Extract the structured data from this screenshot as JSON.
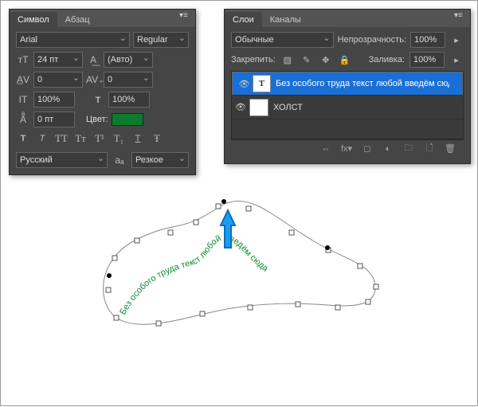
{
  "charPanel": {
    "tabs": [
      "Символ",
      "Абзац"
    ],
    "activeTab": 0,
    "font": "Arial",
    "style": "Regular",
    "size": "24 пт",
    "leading": "(Авто)",
    "kerning": "0",
    "tracking": "0",
    "vscale": "100%",
    "hscale": "100%",
    "baseline": "0 пт",
    "colorLabel": "Цвет:",
    "color": "#0b7b2d",
    "language": "Русский",
    "aa": "Резкое"
  },
  "layersPanel": {
    "tabs": [
      "Слои",
      "Каналы"
    ],
    "activeTab": 0,
    "blendMode": "Обычные",
    "opacityLabel": "Непрозрачность:",
    "opacity": "100%",
    "lockLabel": "Закрепить:",
    "fillLabel": "Заливка:",
    "fill": "100%",
    "layers": [
      {
        "name": "Без особого труда текст любой введём сюда",
        "selected": true,
        "type": "T"
      },
      {
        "name": "ХОЛСТ",
        "selected": false,
        "type": ""
      }
    ]
  },
  "canvasText": "Без особого труда текст любой введём сюда"
}
